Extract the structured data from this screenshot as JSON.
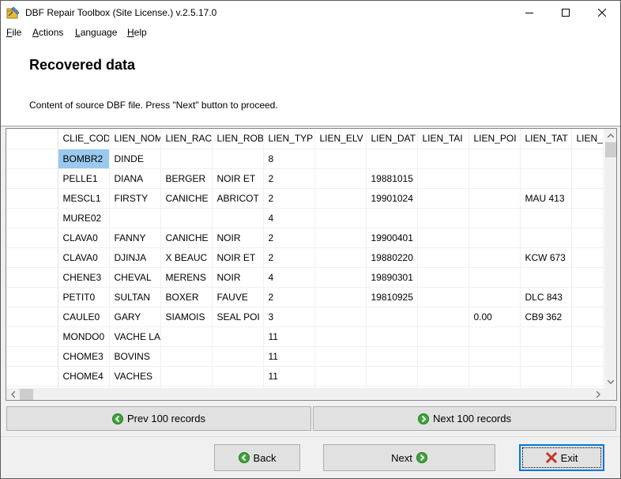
{
  "window": {
    "title": "DBF Repair Toolbox (Site License.) v.2.5.17.0",
    "icon": "app-icon"
  },
  "menu": {
    "file": {
      "underline": "F",
      "rest": "ile"
    },
    "actions": {
      "underline": "A",
      "rest": "ctions"
    },
    "language": {
      "underline": "L",
      "rest": "anguage"
    },
    "help": {
      "underline": "H",
      "rest": "elp"
    }
  },
  "header": {
    "title": "Recovered data",
    "subtitle": "Content of source DBF file. Press \"Next\" button to proceed."
  },
  "grid": {
    "columns": [
      "CLIE_COD",
      "LIEN_NOM",
      "LIEN_RAC",
      "LIEN_ROB",
      "LIEN_TYP",
      "LIEN_ELV",
      "LIEN_DAT",
      "LIEN_TAI",
      "LIEN_POI",
      "LIEN_TAT",
      "LIEN_"
    ],
    "rows": [
      [
        "BOMBR2",
        "DINDE",
        "",
        "",
        "8",
        "",
        "",
        "",
        "",
        "",
        ""
      ],
      [
        "PELLE1",
        "DIANA",
        "BERGER",
        "NOIR ET",
        "2",
        "",
        "19881015",
        "",
        "",
        "",
        ""
      ],
      [
        "MESCL1",
        "FIRSTY",
        "CANICHE",
        "ABRICOT",
        "2",
        "",
        "19901024",
        "",
        "",
        "MAU 413",
        ""
      ],
      [
        "MURE02",
        "",
        "",
        "",
        "4",
        "",
        "",
        "",
        "",
        "",
        ""
      ],
      [
        "CLAVA0",
        "FANNY",
        "CANICHE",
        "NOIR",
        "2",
        "",
        "19900401",
        "",
        "",
        "",
        ""
      ],
      [
        "CLAVA0",
        "DJINJA",
        "X BEAUC",
        "NOIR ET",
        "2",
        "",
        "19880220",
        "",
        "",
        "KCW 673",
        ""
      ],
      [
        "CHENE3",
        "CHEVAL",
        "MERENS",
        "NOIR",
        "4",
        "",
        "19890301",
        "",
        "",
        "",
        ""
      ],
      [
        "PETIT0",
        "SULTAN",
        "BOXER",
        "FAUVE",
        "2",
        "",
        "19810925",
        "",
        "",
        "DLC 843",
        ""
      ],
      [
        "CAULE0",
        "GARY",
        "SIAMOIS",
        "SEAL POI",
        "3",
        "",
        "",
        "",
        "0.00",
        "CB9 362",
        ""
      ],
      [
        "MONDO0",
        "VACHE LA",
        "",
        "",
        "11",
        "",
        "",
        "",
        "",
        "",
        ""
      ],
      [
        "CHOME3",
        "BOVINS",
        "",
        "",
        "11",
        "",
        "",
        "",
        "",
        "",
        ""
      ],
      [
        "CHOME4",
        "VACHES",
        "",
        "",
        "11",
        "",
        "",
        "",
        "",
        "",
        ""
      ],
      [
        "",
        "",
        "",
        "",
        "",
        "",
        "",
        "",
        "",
        "",
        ""
      ]
    ],
    "selected_cell": "BOMBR2"
  },
  "buttons": {
    "prev100": "Prev 100 records",
    "next100": "Next 100 records",
    "back": "Back",
    "next": "Next",
    "exit": "Exit"
  },
  "colors": {
    "selection": "#99c9ef",
    "nav_arrow_green": "#3aa53a",
    "exit_red": "#c0392b",
    "focus_border": "#0078d7"
  }
}
